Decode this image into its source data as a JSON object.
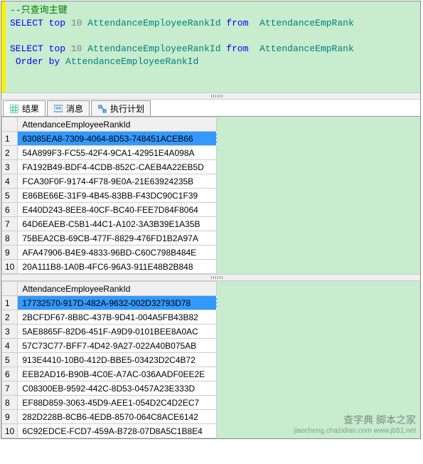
{
  "editor": {
    "comment": "--只查询主键",
    "kw_select": "SELECT",
    "kw_top": "top",
    "lit_10": "10",
    "col": "AttendanceEmployeeRankId",
    "kw_from": "from",
    "tbl": "AttendanceEmpRank",
    "kw_orderby": "Order by"
  },
  "tabs": {
    "results": "结果",
    "messages": "消息",
    "plan": "执行计划"
  },
  "grid": {
    "header": "AttendanceEmployeeRankId",
    "set1": [
      "63085EA8-7309-4064-8D53-748451ACEB66",
      "54A899F3-FC55-42F4-9CA1-42951E4A098A",
      "FA192B49-BDF4-4CDB-852C-CAEB4A22EB5D",
      "FCA30F0F-9174-4F78-9E0A-21E63924235B",
      "E86BE66E-31F9-4B45-83BB-F43DC90C1F39",
      "E440D243-8EE8-40CF-BC40-FEE7D84F8064",
      "64D6EAEB-C5B1-44C1-A102-3A3B39E1A35B",
      "75BEA2CB-69CB-477F-8829-476FD1B2A97A",
      "AFA47906-B4E9-4833-96BD-C60C798B484E",
      "20A111B8-1A0B-4FC6-96A3-911E48B2B848"
    ],
    "set2": [
      "17732570-917D-482A-9632-002D32793D78",
      "2BCFDF67-8B8C-437B-9D41-004A5FB43B82",
      "5AE8865F-82D6-451F-A9D9-0101BEE8A0AC",
      "57C73C77-BFF7-4D42-9A27-022A40B075AB",
      "913E4410-10B0-412D-BBE5-03423D2C4B72",
      "EEB2AD16-B90B-4C0E-A7AC-036AADF0EE2E",
      "C08300EB-9592-442C-8D53-0457A23E333D",
      "EF88D859-3063-45D9-AEE1-054D2C4D2EC7",
      "282D228B-8CB6-4EDB-8570-064C8ACE6142",
      "6C92EDCE-FCD7-459A-B728-07D8A5C1B8E4"
    ]
  },
  "watermark": {
    "main": "查字典 脚本之家",
    "sub": "jiaocheng.chazidian.com  www.jb51.net"
  }
}
